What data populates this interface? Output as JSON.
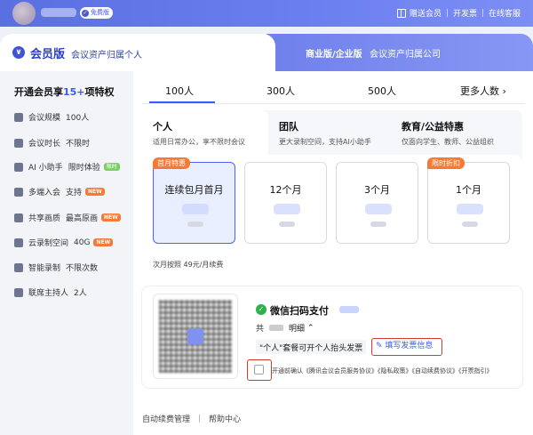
{
  "topbar": {
    "badge": "免费版",
    "links": [
      "赠送会员",
      "开发票",
      "在线客服"
    ]
  },
  "header": {
    "title": "会员版",
    "subtitle": "会议资产归属个人",
    "alt_title": "商业版/企业版",
    "alt_subtitle": "会议资产归属公司"
  },
  "sidebar": {
    "heading_prefix": "开通会员享",
    "heading_count": "15+",
    "heading_suffix": "项特权",
    "perks": [
      {
        "label": "会议规模",
        "value": "100人",
        "icon": "users-icon"
      },
      {
        "label": "会议时长",
        "value": "不限时",
        "icon": "clock-icon"
      },
      {
        "label": "AI 小助手",
        "value": "限时体验",
        "tag": "限时",
        "icon": "ai-icon"
      },
      {
        "label": "多端入会",
        "value": "支持",
        "tag": "NEW",
        "icon": "devices-icon"
      },
      {
        "label": "共享画质",
        "value": "最高原画",
        "tag": "NEW",
        "icon": "screen-icon"
      },
      {
        "label": "云录制空间",
        "value": "40G",
        "tag": "NEW",
        "icon": "cloud-icon"
      },
      {
        "label": "智能录制",
        "value": "不限次数",
        "icon": "record-icon"
      },
      {
        "label": "联席主持人",
        "value": "2人",
        "icon": "cohost-icon"
      }
    ]
  },
  "tabs": [
    "100人",
    "300人",
    "500人",
    "更多人数"
  ],
  "plan_types": [
    {
      "title": "个人",
      "desc": "适用日常办公，享不限时会议"
    },
    {
      "title": "团队",
      "desc": "更大录制空间，支持AI小助手"
    },
    {
      "title": "教育/公益特惠",
      "desc": "仅面向学生、教师、公益组织"
    }
  ],
  "plans": [
    {
      "name": "连续包月首月",
      "badge": "首月特惠"
    },
    {
      "name": "12个月"
    },
    {
      "name": "3个月"
    },
    {
      "name": "1个月",
      "badge": "限时折扣"
    }
  ],
  "next_fee": "次月按照 49元/月续费",
  "payment": {
    "title": "微信扫码支付",
    "total_prefix": "共",
    "detail": "明细",
    "invoice_note": "\"个人\"套餐可开个人抬头发票",
    "invoice_button": "填写发票信息",
    "agreement": "开通前确认《腾讯会议会员服务协议》《隐私政策》《自动续费协议》《开票指引》"
  },
  "footer": [
    "自动续费管理",
    "帮助中心"
  ]
}
